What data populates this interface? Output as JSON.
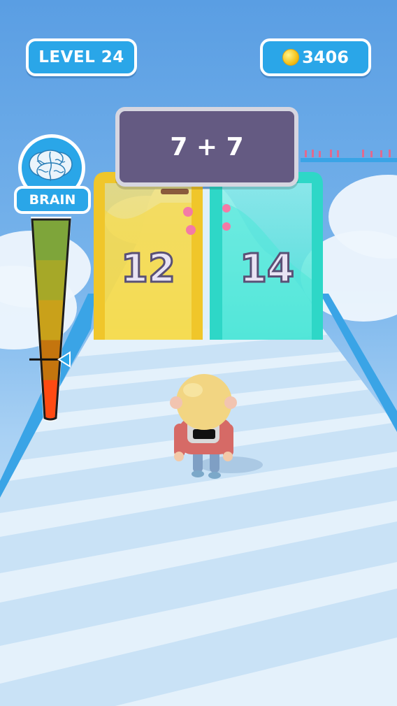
{
  "hud": {
    "level_label": "LEVEL 24",
    "coins": "3406",
    "coin_icon": "coin-icon"
  },
  "question": {
    "text": "7 + 7"
  },
  "gates": {
    "left": {
      "value": "12",
      "color": "#f7dd44"
    },
    "right": {
      "value": "14",
      "color": "#3fe3d3"
    }
  },
  "brain_meter": {
    "label": "BRAIN",
    "icon": "brain-icon",
    "level": 0.3,
    "colors": [
      "#ff4a12",
      "#c4750e",
      "#c9a11a",
      "#a6a828",
      "#7ea53a"
    ]
  },
  "colors": {
    "accent": "#2aa6e8",
    "track": "#e4f1fb",
    "track_border": "#3aa4e6",
    "question_bg": "#645a82"
  }
}
